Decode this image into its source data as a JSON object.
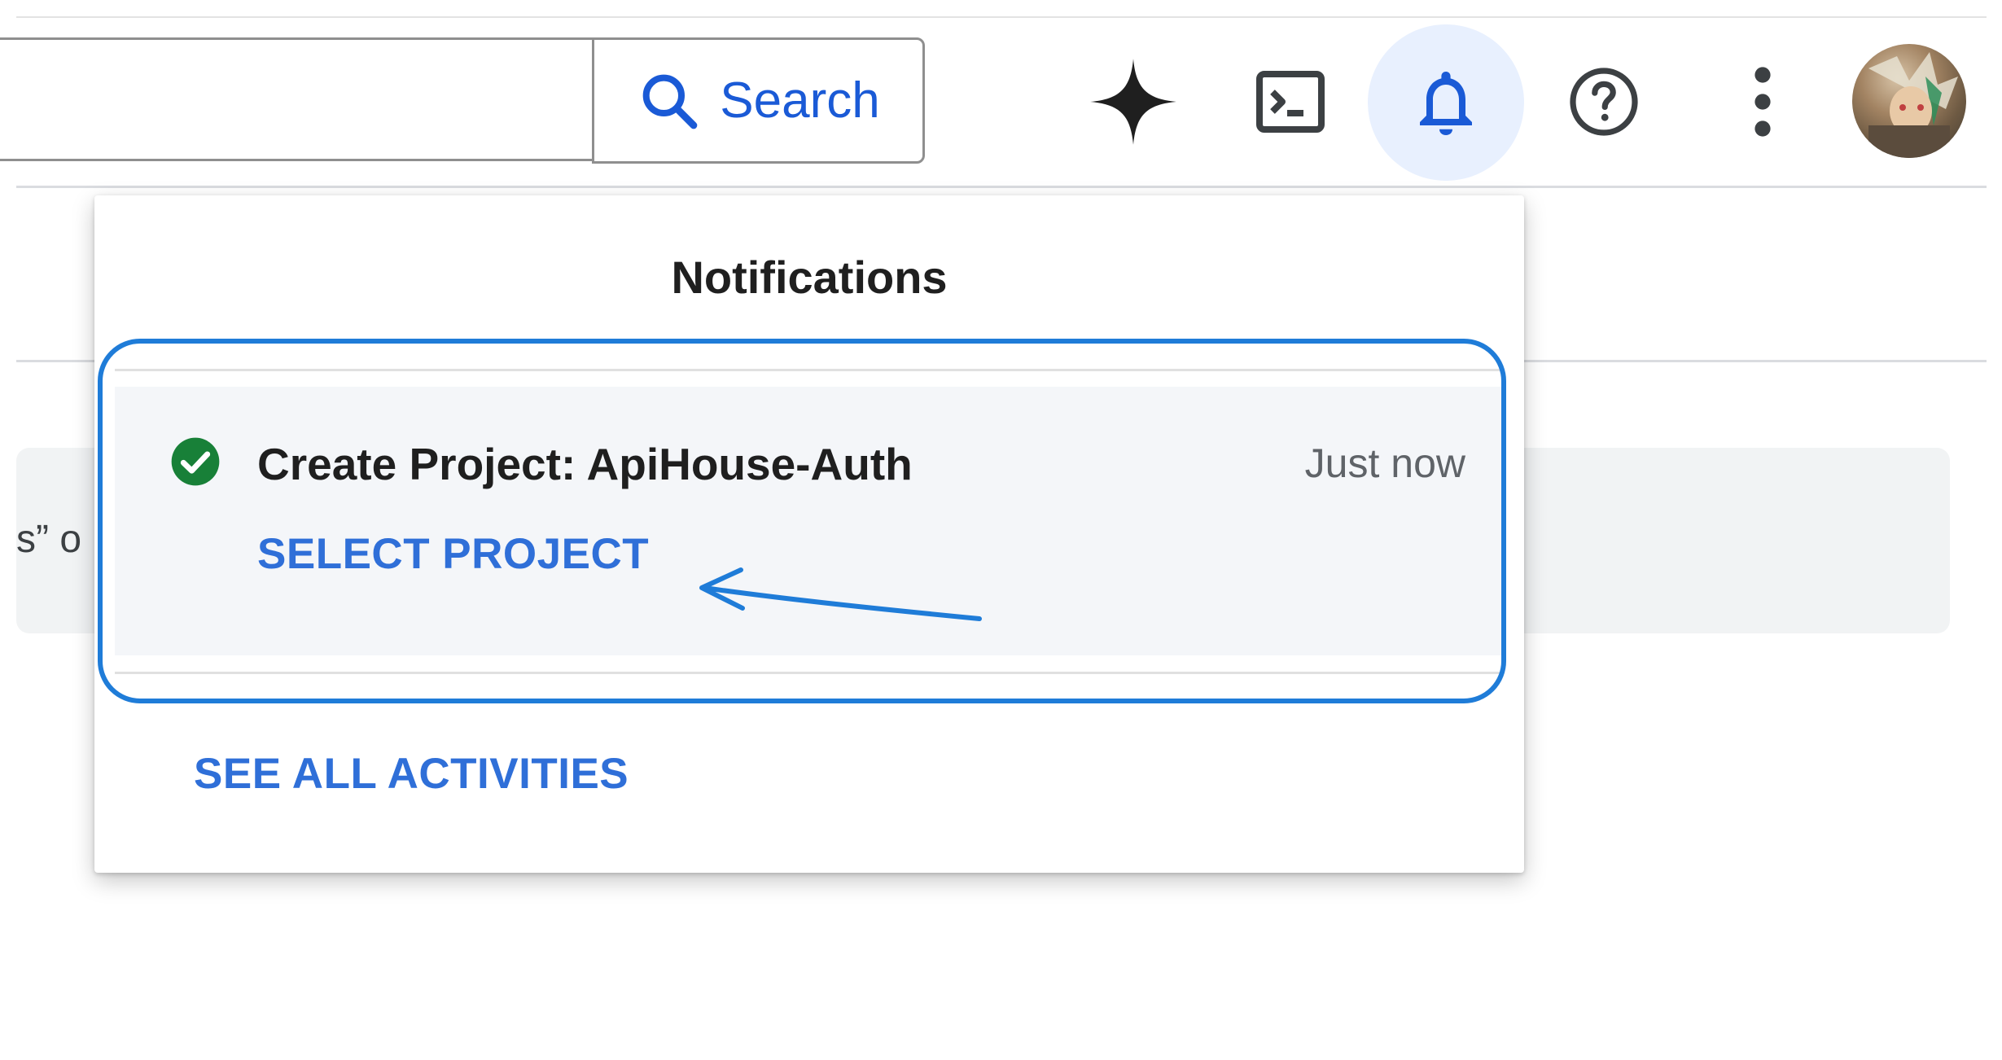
{
  "search": {
    "input_value": "",
    "button_label": "Search"
  },
  "toolbar": {
    "icons": [
      "sparkle-icon",
      "terminal-icon",
      "bell-icon",
      "help-icon",
      "more-vert-icon",
      "avatar"
    ]
  },
  "background": {
    "snippet_text": "s” o"
  },
  "notifications": {
    "title": "Notifications",
    "items": [
      {
        "status_icon": "check-circle-icon",
        "text": "Create Project: ApiHouse-Auth",
        "time": "Just now",
        "action_label": "SELECT PROJECT"
      }
    ],
    "see_all_label": "SEE ALL ACTIVITIES"
  },
  "colors": {
    "accent_blue": "#2f6fd8",
    "success_green": "#188038",
    "annotation_blue": "#1f7cd8",
    "bell_highlight": "#e8f0fe"
  }
}
